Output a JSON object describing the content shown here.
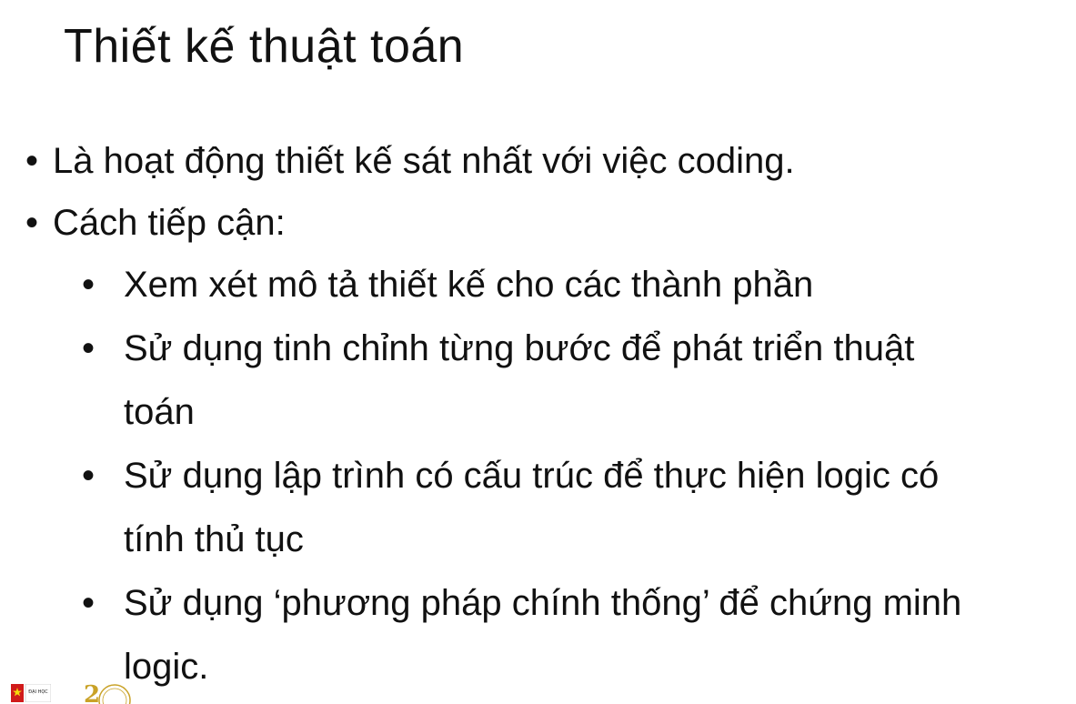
{
  "slide": {
    "title": "Thiết kế thuật toán"
  },
  "bullets": {
    "b1": "Là hoạt động thiết kế sát nhất với việc coding.",
    "b2": "Cách tiếp cận:",
    "sub1": "Xem xét mô tả thiết kế cho các thành phần",
    "sub2_line1": "Sử dụng tinh chỉnh từng bước để phát triển thuật",
    "sub2_line2": "toán",
    "sub3_line1": "Sử dụng lập trình có cấu trúc để thực hiện logic có",
    "sub3_line2": "tính thủ tục",
    "sub4_line1": "Sử dụng ‘phương pháp chính thống’ để chứng minh",
    "sub4_line2": "logic."
  },
  "bullet_char": "•",
  "footer": {
    "flag_label": "ĐẠI HỌC",
    "seal_label": "2"
  },
  "colors": {
    "text": "#111111",
    "background": "#ffffff",
    "flag_red": "#d01a1a",
    "flag_star": "#f5d90a",
    "seal_gold": "#c9a227"
  }
}
